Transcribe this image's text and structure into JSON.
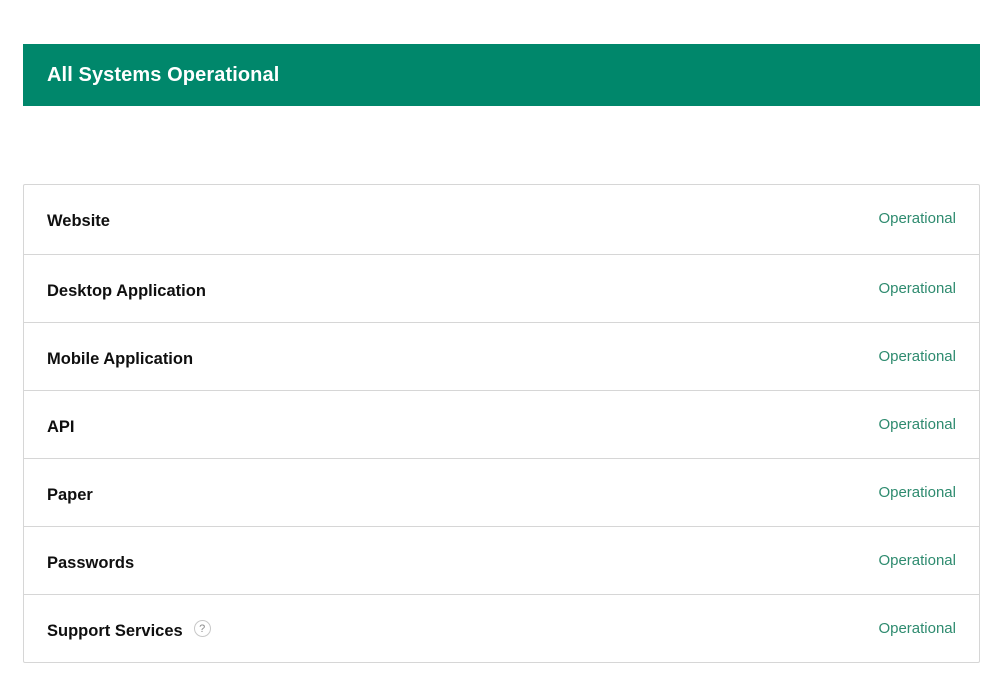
{
  "page": {
    "banner": {
      "title": "All Systems Operational",
      "color": "#00876b"
    },
    "components": [
      {
        "name": "Website",
        "status": "Operational"
      },
      {
        "name": "Desktop Application",
        "status": "Operational"
      },
      {
        "name": "Mobile Application",
        "status": "Operational"
      },
      {
        "name": "API",
        "status": "Operational"
      },
      {
        "name": "Paper",
        "status": "Operational"
      },
      {
        "name": "Passwords",
        "status": "Operational"
      },
      {
        "name": "Support Services",
        "status": "Operational",
        "help_icon": "question-mark-icon",
        "help_glyph": "?"
      }
    ],
    "status_color": "#2e8b6f"
  }
}
